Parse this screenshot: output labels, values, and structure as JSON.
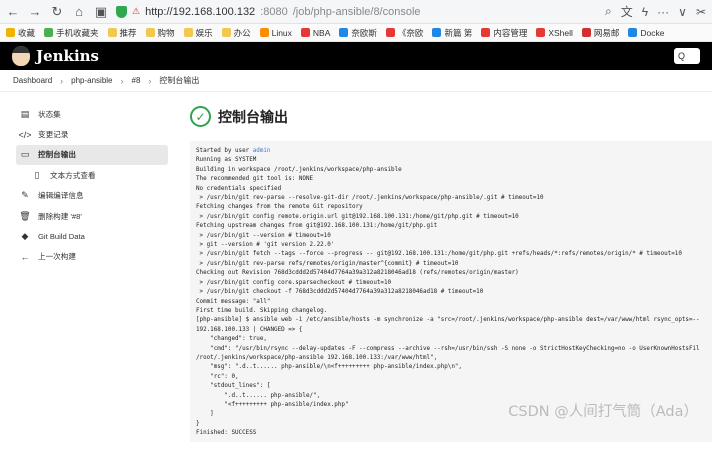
{
  "browser": {
    "url_host": "http://192.168.100.132",
    "url_port": ":8080",
    "url_path": "/job/php-ansible/8/console",
    "right_icons": [
      "search-icon",
      "translate-icon",
      "lightning-icon",
      "more-icon",
      "chevron-icon",
      "cut-icon"
    ]
  },
  "bookmarks": [
    {
      "label": "收藏",
      "color": "#f0b400"
    },
    {
      "label": "手机收藏夹",
      "color": "#4caf50"
    },
    {
      "label": "推荐",
      "color": "#f2c94c"
    },
    {
      "label": "购物",
      "color": "#f2c94c"
    },
    {
      "label": "娱乐",
      "color": "#f2c94c"
    },
    {
      "label": "办公",
      "color": "#f2c94c"
    },
    {
      "label": "Linux",
      "color": "#ff8c00"
    },
    {
      "label": "NBA",
      "color": "#e53935"
    },
    {
      "label": "奈欧斯",
      "color": "#1e88e5"
    },
    {
      "label": "《奈欧",
      "color": "#e53935"
    },
    {
      "label": "新篇 第",
      "color": "#1e88e5"
    },
    {
      "label": "内容管理",
      "color": "#e53935"
    },
    {
      "label": "XShell",
      "color": "#e53935"
    },
    {
      "label": "网易邮",
      "color": "#d32f2f"
    },
    {
      "label": "Docke",
      "color": "#1e88e5"
    }
  ],
  "header": {
    "brand": "Jenkins",
    "search_placeholder": "Q"
  },
  "breadcrumb": {
    "items": [
      "Dashboard",
      "php-ansible",
      "#8",
      "控制台输出"
    ]
  },
  "sidebar": {
    "items": [
      {
        "label": "状态集",
        "icon": "status-icon"
      },
      {
        "label": "变更记录",
        "icon": "code-icon"
      },
      {
        "label": "控制台输出",
        "icon": "terminal-icon",
        "active": true
      },
      {
        "label": "文本方式查看",
        "icon": "document-icon",
        "sub": true
      },
      {
        "label": "编辑编译信息",
        "icon": "edit-icon"
      },
      {
        "label": "删除构建 '#8'",
        "icon": "trash-icon"
      },
      {
        "label": "Git Build Data",
        "icon": "git-icon"
      },
      {
        "label": "上一次构建",
        "icon": "arrow-left-icon"
      }
    ]
  },
  "page": {
    "title": "控制台输出"
  },
  "console": {
    "lines": [
      "Started by user admin",
      "Running as SYSTEM",
      "Building in workspace /root/.jenkins/workspace/php-ansible",
      "The recommended git tool is: NONE",
      "No credentials specified",
      " > /usr/bin/git rev-parse --resolve-git-dir /root/.jenkins/workspace/php-ansible/.git # timeout=10",
      "Fetching changes from the remote Git repository",
      " > /usr/bin/git config remote.origin.url git@192.168.100.131:/home/git/php.git # timeout=10",
      "Fetching upstream changes from git@192.168.100.131:/home/git/php.git",
      " > /usr/bin/git --version # timeout=10",
      " > git --version # 'git version 2.22.0'",
      " > /usr/bin/git fetch --tags --force --progress -- git@192.168.100.131:/home/git/php.git +refs/heads/*:refs/remotes/origin/* # timeout=10",
      " > /usr/bin/git rev-parse refs/remotes/origin/master^{commit} # timeout=10",
      "Checking out Revision 768d3cddd2d57404d7764a39a312a8218046ad18 (refs/remotes/origin/master)",
      " > /usr/bin/git config core.sparsecheckout # timeout=10",
      " > /usr/bin/git checkout -f 768d3cddd2d57404d7764a39a312a8218046ad18 # timeout=10",
      "Commit message: \"all\"",
      "First time build. Skipping changelog.",
      "[php-ansible] $ ansible web -i /etc/ansible/hosts -m synchronize -a \"src=/root/.jenkins/workspace/php-ansible dest=/var/www/html rsync_opts=--",
      "192.168.100.133 | CHANGED => {",
      "    \"changed\": true,",
      "    \"cmd\": \"/usr/bin/rsync --delay-updates -F --compress --archive --rsh=/usr/bin/ssh -S none -o StrictHostKeyChecking=no -o UserKnownHostsFil",
      "/root/.jenkins/workspace/php-ansible 192.168.100.133:/var/www/html\",",
      "    \"msg\": \".d..t...... php-ansible/\\n<f+++++++++ php-ansible/index.php\\n\",",
      "    \"rc\": 0,",
      "    \"stdout_lines\": [",
      "        \".d..t...... php-ansible/\",",
      "        \"<f+++++++++ php-ansible/index.php\"",
      "    ]",
      "}",
      "Finished: SUCCESS"
    ]
  },
  "watermark": "CSDN @人间打气筒（Ada）"
}
